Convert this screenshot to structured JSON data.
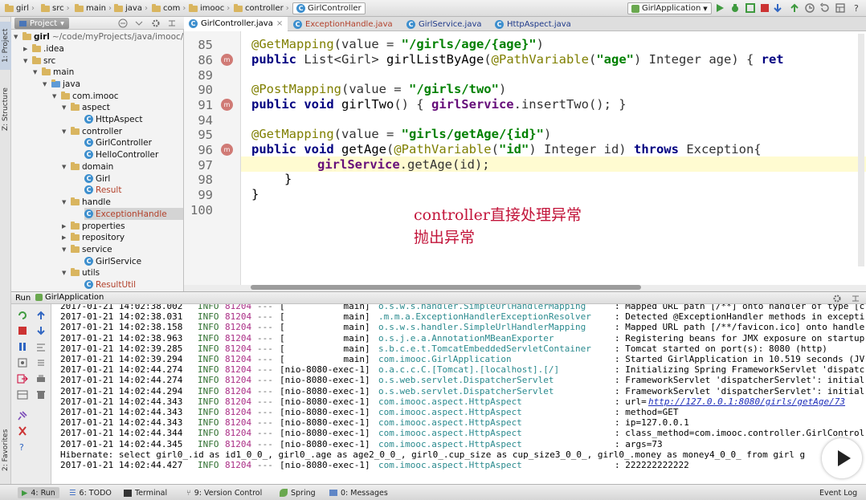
{
  "navbar": {
    "crumbs": [
      "girl",
      "src",
      "main",
      "java",
      "com",
      "imooc",
      "controller",
      "GirlController"
    ],
    "run_config": "GirlApplication"
  },
  "left_stripe": {
    "project_tab": "1: Project",
    "structure_tab": "Z: Structure",
    "favorites_tab": "2: Favorites"
  },
  "project": {
    "header_label": "Project",
    "root": "girl",
    "root_path": "~/code/myProjects/java/imooc/g",
    "items": [
      ".idea",
      "src",
      "main",
      "java",
      "com.imooc",
      "aspect",
      "HttpAspect",
      "controller",
      "GirlController",
      "HelloController",
      "domain",
      "Girl",
      "Result",
      "handle",
      "ExceptionHandle",
      "properties",
      "repository",
      "service",
      "GirlService",
      "utils",
      "ResultUtil"
    ]
  },
  "editor_tabs": [
    "GirlController.java",
    "ExceptionHandle.java",
    "GirlService.java",
    "HttpAspect.java"
  ],
  "gutter": {
    "line_numbers": [
      "85",
      "86",
      "89",
      "90",
      "91",
      "94",
      "95",
      "96",
      "97",
      "98",
      "99",
      "100"
    ],
    "badge": "m"
  },
  "code": {
    "l85_ann": "@GetMapping",
    "l85_a": "(value = ",
    "l85_s": "\"/girls/age/{age}\"",
    "l85_b": ")",
    "l86_kw": "public",
    "l86_a": " List<Girl> ",
    "l86_fn": "girlListByAge",
    "l86_b": "(",
    "l86_ann": "@PathVariable",
    "l86_c": "(",
    "l86_s": "\"age\"",
    "l86_d": ") Integer age) { ",
    "l86_kw2": "ret",
    "l90_ann": "@PostMapping",
    "l90_a": "(value = ",
    "l90_s": "\"/girls/two\"",
    "l90_b": ")",
    "l91_kw": "public void",
    "l91_fn": " girlTwo",
    "l91_a": "() { ",
    "l91_fd": "girlService",
    "l91_b": ".insertTwo(); }",
    "l95_ann": "@GetMapping",
    "l95_a": "(value = ",
    "l95_s": "\"girls/getAge/{id}\"",
    "l95_b": ")",
    "l96_kw": "public void",
    "l96_fn": " getAge",
    "l96_a": "(",
    "l96_ann": "@PathVariable",
    "l96_b": "(",
    "l96_s": "\"id\"",
    "l96_c": ") Integer id) ",
    "l96_kw2": "throws",
    "l96_d": " Exception{",
    "l97_fd": "girlService",
    "l97_a": ".getAge(id);",
    "l98": "}",
    "l99": "}"
  },
  "overlay": {
    "line1": "controller直接处理异常",
    "line2": "抛出异常"
  },
  "run": {
    "header": "Run",
    "config": "GirlApplication",
    "log_rows": [
      {
        "date": "2017-01-21 14:02:38.002",
        "level": "INFO",
        "pid": "81204",
        "dash": "---",
        "thread": "[           main]",
        "logger": "o.s.w.s.handler.SimpleUrlHandlerMapping",
        "msg": ": Mapped URL path [/**] onto handler of type [c"
      },
      {
        "date": "2017-01-21 14:02:38.031",
        "level": "INFO",
        "pid": "81204",
        "dash": "---",
        "thread": "[           main]",
        "logger": ".m.m.a.ExceptionHandlerExceptionResolver",
        "msg": ": Detected @ExceptionHandler methods in excepti"
      },
      {
        "date": "2017-01-21 14:02:38.158",
        "level": "INFO",
        "pid": "81204",
        "dash": "---",
        "thread": "[           main]",
        "logger": "o.s.w.s.handler.SimpleUrlHandlerMapping",
        "msg": ": Mapped URL path [/**/favicon.ico] onto handle"
      },
      {
        "date": "2017-01-21 14:02:38.963",
        "level": "INFO",
        "pid": "81204",
        "dash": "---",
        "thread": "[           main]",
        "logger": "o.s.j.e.a.AnnotationMBeanExporter",
        "msg": ": Registering beans for JMX exposure on startup"
      },
      {
        "date": "2017-01-21 14:02:39.285",
        "level": "INFO",
        "pid": "81204",
        "dash": "---",
        "thread": "[           main]",
        "logger": "s.b.c.e.t.TomcatEmbeddedServletContainer",
        "msg": ": Tomcat started on port(s): 8080 (http)"
      },
      {
        "date": "2017-01-21 14:02:39.294",
        "level": "INFO",
        "pid": "81204",
        "dash": "---",
        "thread": "[           main]",
        "logger": "com.imooc.GirlApplication",
        "msg": ": Started GirlApplication in 10.519 seconds (JV"
      },
      {
        "date": "2017-01-21 14:02:44.274",
        "level": "INFO",
        "pid": "81204",
        "dash": "---",
        "thread": "[nio-8080-exec-1]",
        "logger": "o.a.c.c.C.[Tomcat].[localhost].[/]",
        "msg": ": Initializing Spring FrameworkServlet 'dispatc"
      },
      {
        "date": "2017-01-21 14:02:44.274",
        "level": "INFO",
        "pid": "81204",
        "dash": "---",
        "thread": "[nio-8080-exec-1]",
        "logger": "o.s.web.servlet.DispatcherServlet",
        "msg": ": FrameworkServlet 'dispatcherServlet': initial"
      },
      {
        "date": "2017-01-21 14:02:44.294",
        "level": "INFO",
        "pid": "81204",
        "dash": "---",
        "thread": "[nio-8080-exec-1]",
        "logger": "o.s.web.servlet.DispatcherServlet",
        "msg": ": FrameworkServlet 'dispatcherServlet': initial"
      },
      {
        "date": "2017-01-21 14:02:44.343",
        "level": "INFO",
        "pid": "81204",
        "dash": "---",
        "thread": "[nio-8080-exec-1]",
        "logger": "com.imooc.aspect.HttpAspect",
        "msg": ": url=",
        "url": "http://127.0.0.1:8080/girls/getAge/73"
      },
      {
        "date": "2017-01-21 14:02:44.343",
        "level": "INFO",
        "pid": "81204",
        "dash": "---",
        "thread": "[nio-8080-exec-1]",
        "logger": "com.imooc.aspect.HttpAspect",
        "msg": ": method=GET"
      },
      {
        "date": "2017-01-21 14:02:44.343",
        "level": "INFO",
        "pid": "81204",
        "dash": "---",
        "thread": "[nio-8080-exec-1]",
        "logger": "com.imooc.aspect.HttpAspect",
        "msg": ": ip=127.0.0.1"
      },
      {
        "date": "2017-01-21 14:02:44.344",
        "level": "INFO",
        "pid": "81204",
        "dash": "---",
        "thread": "[nio-8080-exec-1]",
        "logger": "com.imooc.aspect.HttpAspect",
        "msg": ": class_method=com.imooc.controller.GirlControl"
      },
      {
        "date": "2017-01-21 14:02:44.345",
        "level": "INFO",
        "pid": "81204",
        "dash": "---",
        "thread": "[nio-8080-exec-1]",
        "logger": "com.imooc.aspect.HttpAspect",
        "msg": ": args=73"
      },
      {
        "plain": "Hibernate: select girl0_.id as id1_0_0_, girl0_.age as age2_0_0_, girl0_.cup_size as cup_size3_0_0_, girl0_.money as money4_0_0_ from girl g"
      },
      {
        "date": "2017-01-21 14:02:44.427",
        "level": "INFO",
        "pid": "81204",
        "dash": "---",
        "thread": "[nio-8080-exec-1]",
        "logger": "com.imooc.aspect.HttpAspect",
        "msg": ": 222222222222"
      }
    ]
  },
  "bottom": {
    "run_tab": "4: Run",
    "todo_tab": "6: TODO",
    "terminal_tab": "Terminal",
    "vcs_tab": "9: Version Control",
    "spring_tab": "Spring",
    "messages_tab": "0: Messages",
    "event_log": "Event Log"
  },
  "colors": {
    "overlay_text": "#c2143a",
    "annotation": "#7f7f00",
    "string": "#008000",
    "keyword": "#000080",
    "field": "#660e7a"
  }
}
